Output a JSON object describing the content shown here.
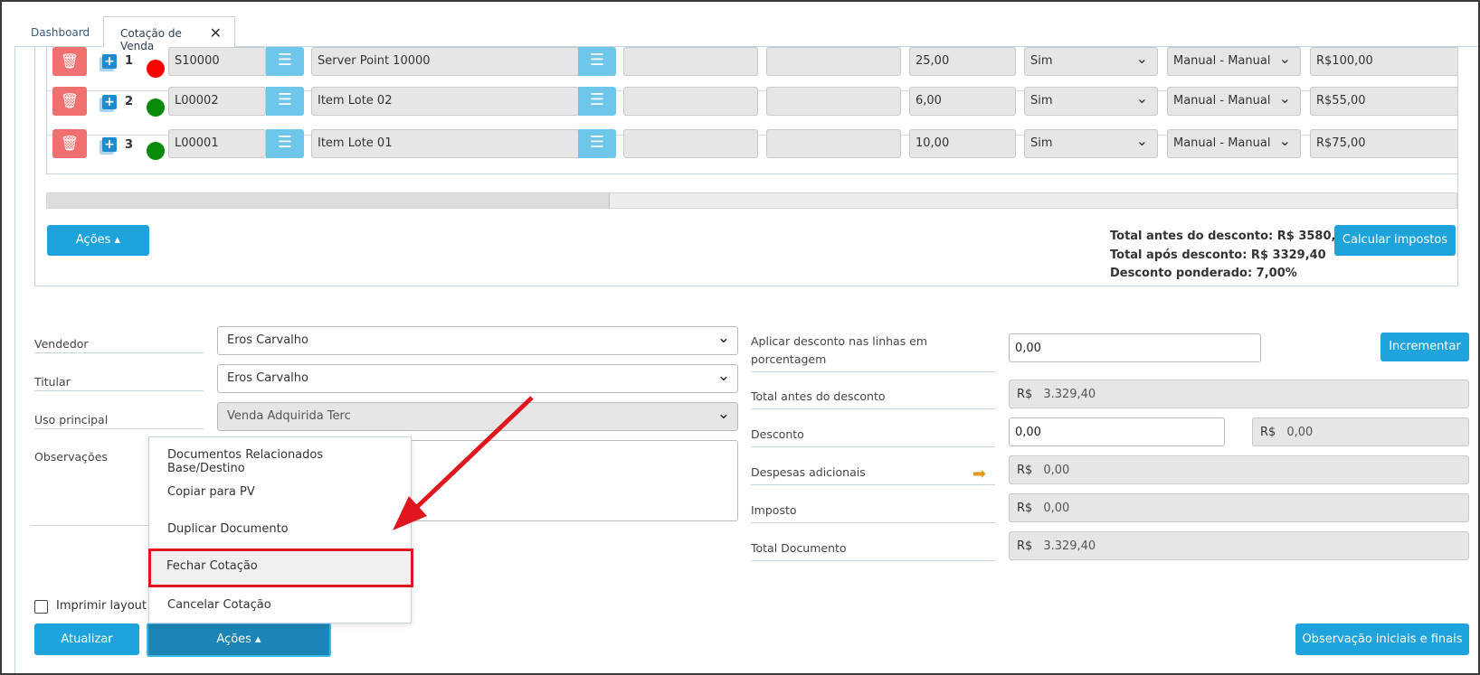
{
  "tabs": [
    {
      "label": "Dashboard"
    },
    {
      "label": "Cotação de Venda",
      "close": "✕"
    }
  ],
  "grid": {
    "rows": [
      {
        "num": "1",
        "code": "S10000",
        "desc": "Server Point 10000",
        "qty": "25,00",
        "flag": "Sim",
        "mode": "Manual - Manual",
        "price": "R$100,00",
        "status_color": "#ff0000"
      },
      {
        "num": "2",
        "code": "L00002",
        "desc": "Item Lote 02",
        "qty": "6,00",
        "flag": "Sim",
        "mode": "Manual - Manual",
        "price": "R$55,00",
        "status_color": "#0a8a0a"
      },
      {
        "num": "3",
        "code": "L00001",
        "desc": "Item Lote 01",
        "qty": "10,00",
        "flag": "Sim",
        "mode": "Manual - Manual",
        "price": "R$75,00",
        "status_color": "#0a8a0a"
      }
    ]
  },
  "panel": {
    "acoes_label": "Ações ▴",
    "total_antes": "Total antes do desconto: R$ 3580,00",
    "total_apos": "Total após desconto: R$ 3329,40",
    "desconto_ponderado": "Desconto ponderado: 7,00%",
    "calcular_label": "Calcular impostos"
  },
  "form": {
    "vendedor_label": "Vendedor",
    "vendedor_value": "Eros Carvalho",
    "titular_label": "Titular",
    "titular_value": "Eros Carvalho",
    "uso_label": "Uso principal",
    "uso_value": "Venda Adquirida Terc",
    "obs_label": "Observações",
    "imprimir_label": "Imprimir layout a"
  },
  "right": {
    "aplicar_label": "Aplicar desconto nas linhas em porcentagem",
    "aplicar_value": "0,00",
    "incrementar_label": "Incrementar",
    "total_antes_label": "Total antes do desconto",
    "total_antes_value": "3.329,40",
    "desconto_label": "Desconto",
    "desconto_value": "0,00",
    "desconto_rs_value": "0,00",
    "despesas_label": "Despesas adicionais",
    "despesas_value": "0,00",
    "imposto_label": "Imposto",
    "imposto_value": "0,00",
    "total_doc_label": "Total Documento",
    "total_doc_value": "3.329,40",
    "currency": "R$"
  },
  "menu": {
    "items": [
      {
        "label": "Documentos Relacionados Base/Destino"
      },
      {
        "label": "Copiar para PV"
      },
      {
        "label": "Duplicar Documento"
      },
      {
        "label": "Fechar Cotação"
      },
      {
        "label": "Cancelar Cotação"
      }
    ]
  },
  "footer": {
    "atualizar_label": "Atualizar",
    "acoes_label": "Ações ▴",
    "obs_label": "Observação iniciais e finais"
  },
  "icons": {
    "trash": "trash-icon",
    "list": "list-icon",
    "plus": "add-copy-icon",
    "arrow": "arrow-right-icon"
  },
  "colors": {
    "accent": "#1fa3dc",
    "delete": "#f07070",
    "highlight": "#e0161e"
  }
}
